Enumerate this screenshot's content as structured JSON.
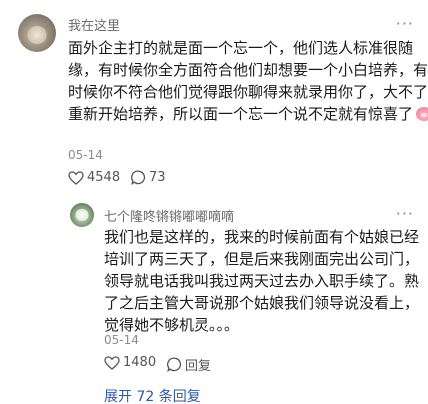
{
  "main_comment": {
    "username": "我在这里",
    "more": "···",
    "lines": [
      "面外企主打的就是面一个忘一个，他们选人标准很随",
      "缘，有时候你全方面符合他们却想要一个小白培养，有",
      "时候你不符合他们觉得跟你聊得来就录用你了，大不了",
      "重新开始培养，所以面一个忘一个说不定就有惊喜了"
    ],
    "emoji": "pig-face-emoji",
    "date": "05-14",
    "like_count": "4548",
    "comment_count": "73"
  },
  "reply": {
    "username": "七个隆咚锵锵嘟嘟嘀嘀",
    "more": "···",
    "lines": [
      "我们也是这样的，我来的时候前面有个姑娘已经",
      "培训了两三天了，但是后来我刚面完出公司门，",
      "领导就电话我叫我过两天过去办入职手续了。熟",
      "了之后主管大哥说那个姑娘我们领导说没看上，",
      "觉得她不够机灵。。。"
    ],
    "date": "05-14",
    "like_count": "1480",
    "reply_label": "回复"
  },
  "expand_label": "展开 72 条回复",
  "colors": {
    "link": "#2b5aa8",
    "muted": "#8c8c8c"
  }
}
